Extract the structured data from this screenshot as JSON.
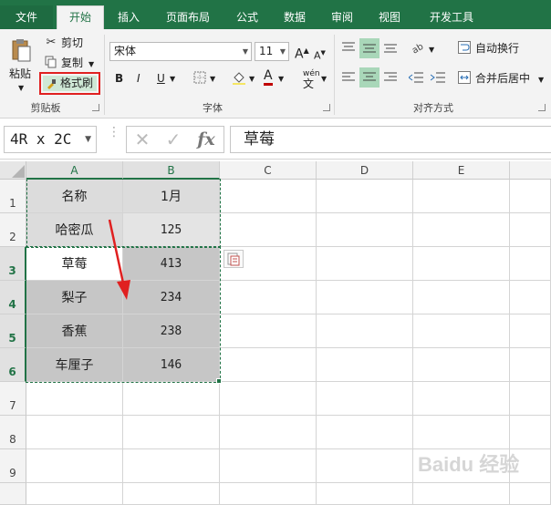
{
  "tabs": [
    "文件",
    "开始",
    "插入",
    "页面布局",
    "公式",
    "数据",
    "审阅",
    "视图",
    "开发工具"
  ],
  "clipboard": {
    "paste": "粘贴",
    "cut": "剪切",
    "copy": "复制",
    "format_painter": "格式刷",
    "group_label": "剪贴板"
  },
  "font": {
    "name": "宋体",
    "size": "11",
    "bold": "B",
    "italic": "I",
    "underline": "U",
    "grow": "A",
    "shrink": "A",
    "text_color_label": "A",
    "phonetic": "wén",
    "group_label": "字体"
  },
  "alignment": {
    "wrap_text": "自动换行",
    "merge_center": "合并后居中",
    "group_label": "对齐方式"
  },
  "formula_bar": {
    "name_box": "4R x 2C",
    "fx": "fx",
    "content": "草莓"
  },
  "columns": [
    "A",
    "B",
    "C",
    "D",
    "E"
  ],
  "rows": [
    "1",
    "2",
    "3",
    "4",
    "5",
    "6",
    "7",
    "8",
    "9"
  ],
  "table": [
    [
      "名称",
      "1月"
    ],
    [
      "哈密瓜",
      "125"
    ],
    [
      "草莓",
      "413"
    ],
    [
      "梨子",
      "234"
    ],
    [
      "香蕉",
      "238"
    ],
    [
      "车厘子",
      "146"
    ]
  ],
  "watermark": "Baidu 经验",
  "colors": {
    "accent": "#217346",
    "highlight_box": "#e02020",
    "arrow": "#e02020"
  }
}
